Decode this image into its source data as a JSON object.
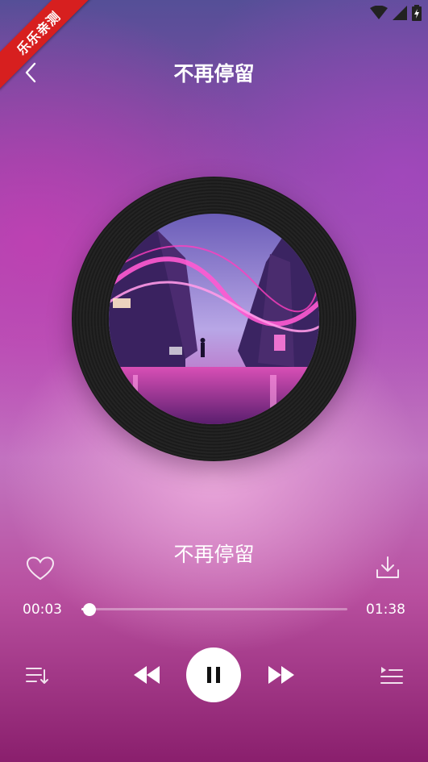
{
  "ribbon": {
    "text": "乐乐亲测"
  },
  "header": {
    "title": "不再停留"
  },
  "song": {
    "title": "不再停留"
  },
  "player": {
    "current_time": "00:03",
    "total_time": "01:38",
    "progress_fraction": 0.031,
    "is_playing": true
  },
  "colors": {
    "ribbon": "#d71f1f",
    "accent": "#ffffff",
    "disc": "#1b1b1b"
  }
}
